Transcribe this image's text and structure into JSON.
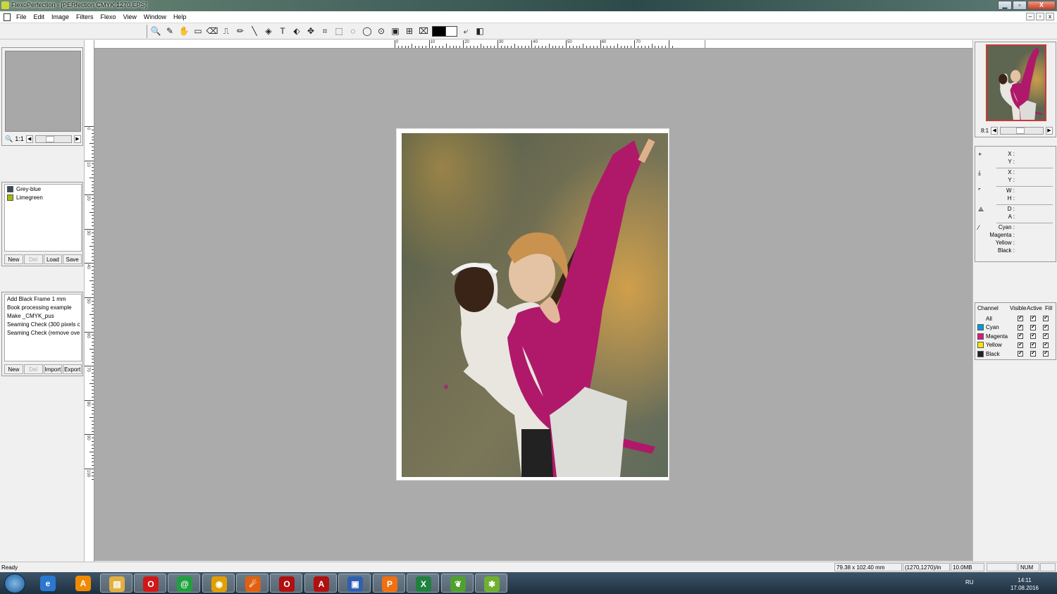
{
  "window": {
    "title": "FlexoPerfection - [PERfection CMYK 1270.EPS]",
    "controls": {
      "minimize": "▁",
      "maximize": "▫",
      "close": "X"
    }
  },
  "menu": {
    "items": [
      "File",
      "Edit",
      "Image",
      "Filters",
      "Flexo",
      "View",
      "Window",
      "Help"
    ],
    "mdi_controls": {
      "minimize": "–",
      "restore": "▫",
      "close": "x"
    }
  },
  "toolbar": {
    "tools": [
      {
        "name": "zoom-tool",
        "glyph": "🔍"
      },
      {
        "name": "eyedropper-tool",
        "glyph": "✎"
      },
      {
        "name": "hand-tool",
        "glyph": "✋"
      },
      {
        "name": "ruler-tool",
        "glyph": "▭"
      },
      {
        "name": "eraser-tool",
        "glyph": "⌫"
      },
      {
        "name": "stamp-tool",
        "glyph": "⎍"
      },
      {
        "name": "pencil-tool",
        "glyph": "✏"
      },
      {
        "name": "line-tool",
        "glyph": "╲"
      },
      {
        "name": "fill-tool",
        "glyph": "◈"
      },
      {
        "name": "text-tool",
        "glyph": "T"
      },
      {
        "name": "shape-tool",
        "glyph": "⬖"
      },
      {
        "name": "move-tool",
        "glyph": "✥"
      },
      {
        "name": "crop-tool",
        "glyph": "⌗"
      },
      {
        "name": "rect-select-tool",
        "glyph": "⬚"
      },
      {
        "name": "ellipse-select-tool",
        "glyph": "◌"
      },
      {
        "name": "lasso-tool",
        "glyph": "◯"
      },
      {
        "name": "magic-wand-tool",
        "glyph": "⊙"
      },
      {
        "name": "mask-tool",
        "glyph": "▣"
      },
      {
        "name": "transform-tool",
        "glyph": "⊞"
      },
      {
        "name": "distort-tool",
        "glyph": "⌧"
      }
    ],
    "after_tools": [
      {
        "name": "swap-colors-icon",
        "glyph": "⤶"
      },
      {
        "name": "reset-colors-icon",
        "glyph": "◧"
      }
    ]
  },
  "navigator": {
    "zoom": "1:1"
  },
  "colors": {
    "items": [
      {
        "label": "Grey-blue",
        "color": "#3a4a58"
      },
      {
        "label": "Limegreen",
        "color": "#a8b800"
      }
    ],
    "buttons": [
      "New",
      "Del",
      "Load",
      "Save"
    ]
  },
  "actions": {
    "items": [
      "Add Black Frame 1 mm",
      "Book processing example",
      "Make _CMYK_pus",
      "Seaming Check (300 pixels c",
      "Seaming Check (remove ove"
    ],
    "buttons": [
      "New",
      "Del",
      "Import",
      "Export"
    ]
  },
  "rulers": {
    "horizontal_labels": [
      "0",
      "10",
      "20",
      "30",
      "40",
      "50",
      "60",
      "70"
    ],
    "vertical_labels": [
      "0",
      "10",
      "20",
      "30",
      "40",
      "50",
      "60",
      "70",
      "80",
      "90",
      "100"
    ]
  },
  "thumbnail": {
    "zoom": "8:1"
  },
  "info": {
    "groups": [
      {
        "icon": "crosshair-icon",
        "glyph": "+",
        "fields": [
          "X :",
          "Y :"
        ]
      },
      {
        "icon": "anchor-icon",
        "glyph": "⤓",
        "fields": [
          "X :",
          "Y :"
        ]
      },
      {
        "icon": "size-icon",
        "glyph": "⌜",
        "fields": [
          "W :",
          "H :"
        ]
      },
      {
        "icon": "angle-icon",
        "glyph": "⟁",
        "fields": [
          "D :",
          "A :"
        ]
      },
      {
        "icon": "eyedropper-icon",
        "glyph": "⁄",
        "fields": [
          "Cyan :",
          "Magenta :",
          "Yellow :",
          "Black :"
        ]
      }
    ]
  },
  "channels": {
    "headers": [
      "Channel",
      "Visible",
      "Active",
      "Fill"
    ],
    "rows": [
      {
        "name": "All",
        "color": null
      },
      {
        "name": "Cyan",
        "color": "#0099e0"
      },
      {
        "name": "Magenta",
        "color": "#e0157e"
      },
      {
        "name": "Yellow",
        "color": "#f5e800"
      },
      {
        "name": "Black",
        "color": "#222222"
      }
    ]
  },
  "status": {
    "ready": "Ready",
    "size": "79.38 x 102.40 mm",
    "resolution": "(1270,1270)/in",
    "memory": "10.0MB",
    "num": "NUM"
  },
  "taskbar": {
    "apps": [
      {
        "name": "ie-icon",
        "label": "e",
        "color": "#2a78d0"
      },
      {
        "name": "avast-icon",
        "label": "A",
        "color": "#f08a00"
      },
      {
        "name": "explorer-icon",
        "label": "▤",
        "color": "#e0b040"
      },
      {
        "name": "opera-icon",
        "label": "O",
        "color": "#d01818"
      },
      {
        "name": "mail-agent-icon",
        "label": "@",
        "color": "#20a040"
      },
      {
        "name": "chrome-icon",
        "label": "◉",
        "color": "#e0a000"
      },
      {
        "name": "firefox-icon",
        "label": "☄",
        "color": "#e06010"
      },
      {
        "name": "opera-gx-icon",
        "label": "O",
        "color": "#b01010"
      },
      {
        "name": "acrobat-icon",
        "label": "A",
        "color": "#b01010"
      },
      {
        "name": "remote-desktop-icon",
        "label": "▣",
        "color": "#3060b0"
      },
      {
        "name": "pdf-creator-icon",
        "label": "P",
        "color": "#f07010"
      },
      {
        "name": "excel-icon",
        "label": "X",
        "color": "#208040"
      },
      {
        "name": "flexo-green-icon",
        "label": "❦",
        "color": "#50a030"
      },
      {
        "name": "flexoperfection-icon",
        "label": "✱",
        "color": "#70b030"
      }
    ],
    "tray": {
      "lang": "RU",
      "time": "14:11",
      "date": "17.08.2016"
    }
  }
}
